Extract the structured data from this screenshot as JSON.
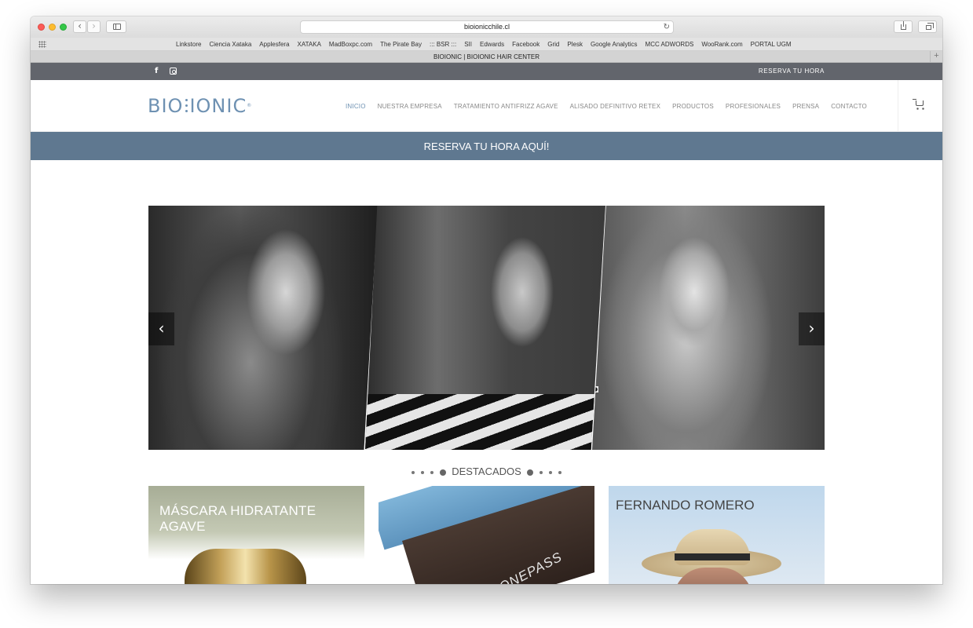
{
  "browser": {
    "url": "bioionicchile.cl",
    "tab_title": "BIOIONIC | BIOIONIC HAIR CENTER",
    "bookmarks": [
      "Linkstore",
      "Ciencia Xataka",
      "Applesfera",
      "XATAKA",
      "MadBoxpc.com",
      "The Pirate Bay",
      "::: BSR :::",
      "SII",
      "Edwards",
      "Facebook",
      "Grid",
      "Plesk",
      "Google Analytics",
      "MCC ADWORDS",
      "WooRank.com",
      "PORTAL UGM"
    ]
  },
  "topbar": {
    "cta": "RESERVA TU HORA"
  },
  "header": {
    "logo_left": "BIO",
    "logo_right": "IONIC",
    "logo_mark": "®",
    "nav": [
      "INICIO",
      "NUESTRA EMPRESA",
      "TRATAMIENTO ANTIFRIZZ AGAVE",
      "ALISADO DEFINITIVO RETEX",
      "PRODUCTOS",
      "PROFESIONALES",
      "PRENSA",
      "CONTACTO"
    ],
    "active_nav": "INICIO"
  },
  "banner": {
    "text": "RESERVA TU HORA AQUÍ!"
  },
  "slider": {
    "prev": "‹",
    "next": "›"
  },
  "featured": {
    "title": "DESTACADOS",
    "cards": [
      {
        "title": "MÁSCARA HIDRATANTE AGAVE"
      },
      {
        "title": "ONEPASS"
      },
      {
        "title": "FERNANDO ROMERO"
      }
    ]
  },
  "colors": {
    "accent": "#6e91b2",
    "topbar": "#62656c",
    "banner": "#5f7890"
  }
}
